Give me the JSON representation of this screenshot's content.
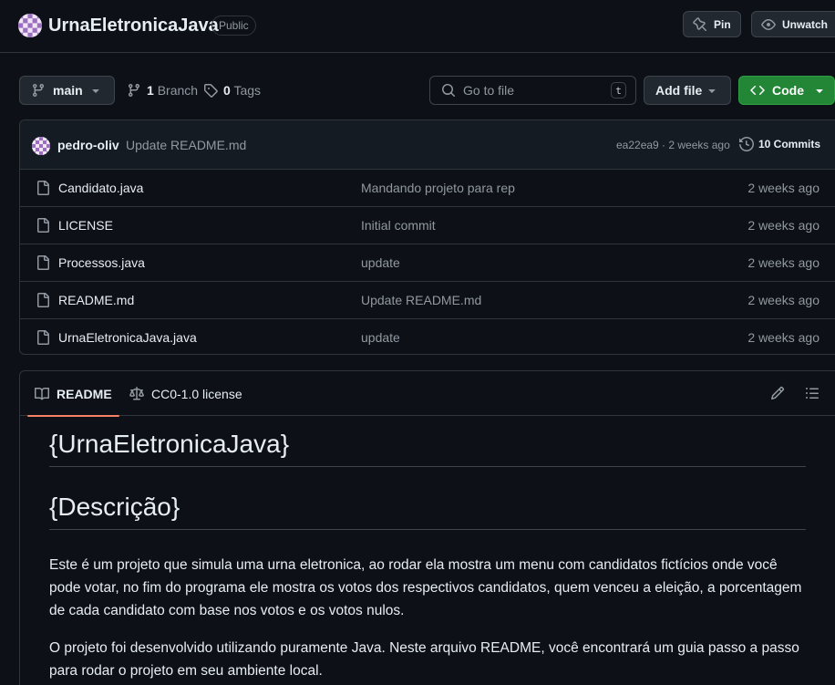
{
  "repo": {
    "name": "UrnaEletronicaJava",
    "visibility": "Public",
    "pin_label": "Pin",
    "unwatch_label": "Unwatch"
  },
  "toolbar": {
    "branch": "main",
    "branch_count": "1",
    "branch_label": "Branch",
    "tag_count": "0",
    "tag_label": "Tags",
    "search_placeholder": "Go to file",
    "search_shortcut": "t",
    "add_file_label": "Add file",
    "code_label": "Code"
  },
  "commit": {
    "author": "pedro-oliv",
    "message": "Update README.md",
    "meta": "ea22ea9 · 2 weeks ago",
    "count_label": "10 Commits"
  },
  "files": [
    {
      "name": "Candidato.java",
      "message": "Mandando projeto para rep",
      "date": "2 weeks ago"
    },
    {
      "name": "LICENSE",
      "message": "Initial commit",
      "date": "2 weeks ago"
    },
    {
      "name": "Processos.java",
      "message": "update",
      "date": "2 weeks ago"
    },
    {
      "name": "README.md",
      "message": "Update README.md",
      "date": "2 weeks ago"
    },
    {
      "name": "UrnaEletronicaJava.java",
      "message": "update",
      "date": "2 weeks ago"
    }
  ],
  "readme": {
    "tab_readme": "README",
    "tab_license": "CC0-1.0 license",
    "heading1": "{UrnaEletronicaJava}",
    "heading2": "{Descrição}",
    "paragraph1": "Este é um projeto que simula uma urna eletronica, ao rodar ela mostra um menu com candidatos fictícios onde você pode votar, no fim do programa ele mostra os votos dos respectivos candidatos, quem venceu a eleição, a porcentagem de cada candidato com base nos votos e os votos nulos.",
    "paragraph2": "O projeto foi desenvolvido utilizando puramente Java. Neste arquivo README, você encontrará um guia passo a passo para rodar o projeto em seu ambiente local."
  },
  "colors": {
    "background": "#0d1117",
    "accent_green": "#238636",
    "tab_underline": "#f78166",
    "border": "#30363d"
  }
}
